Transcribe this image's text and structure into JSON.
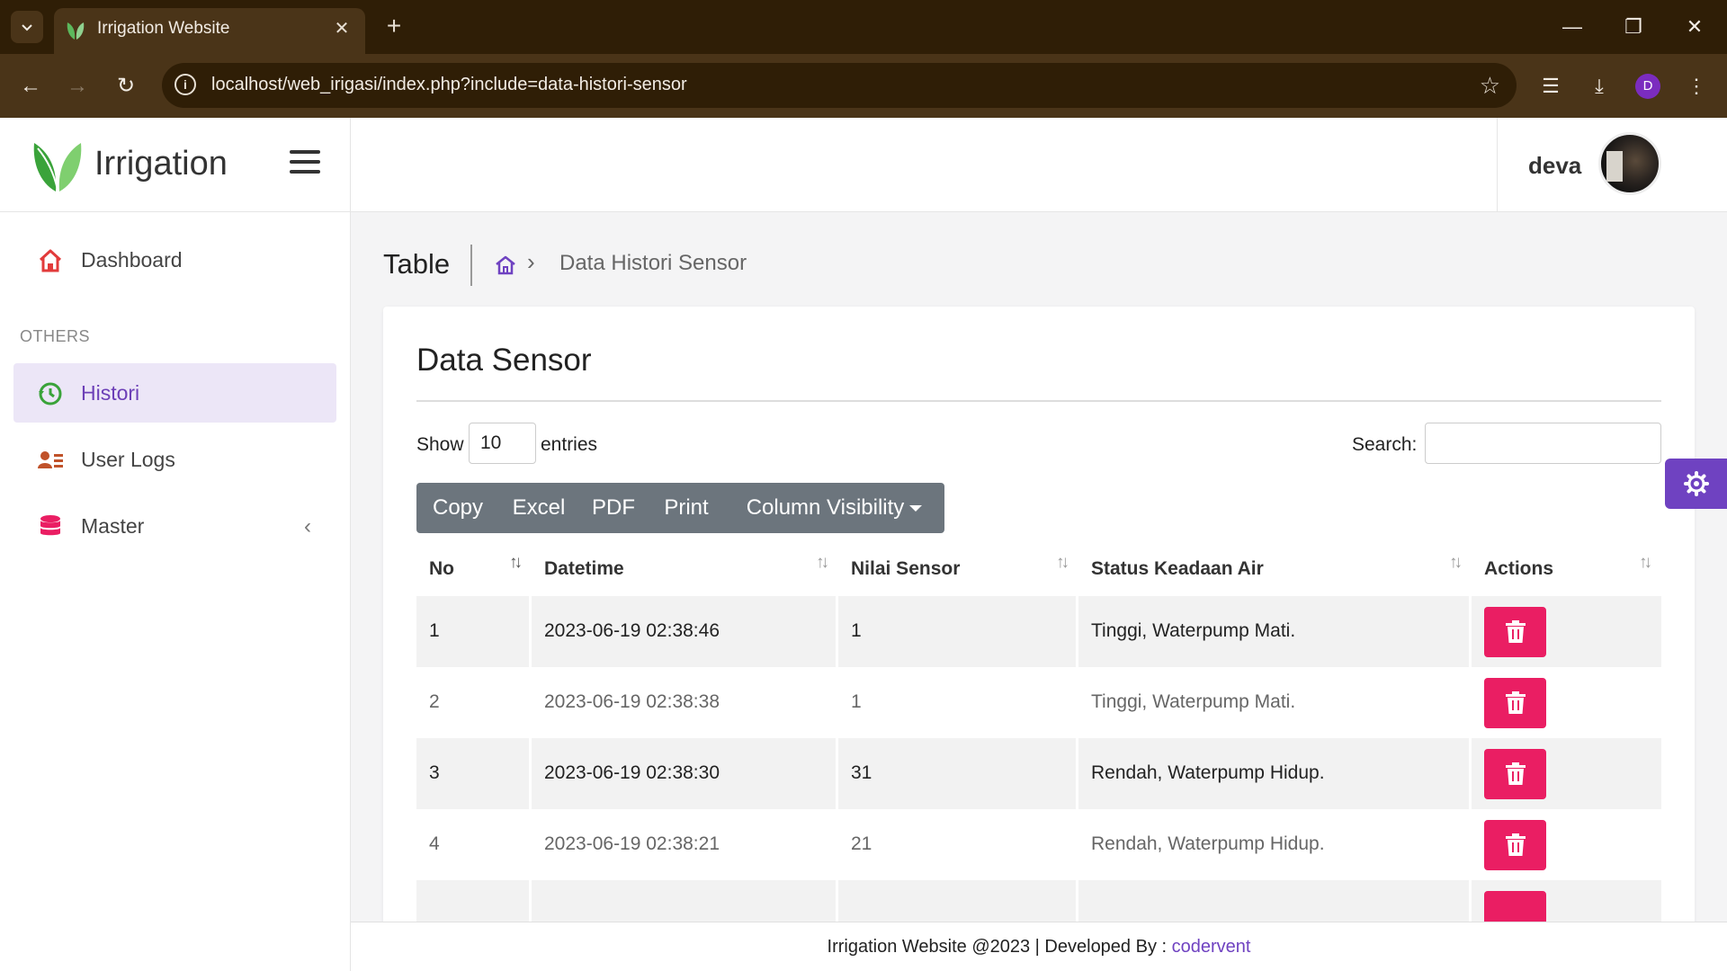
{
  "browser": {
    "tab_title": "Irrigation Website",
    "url": "localhost/web_irigasi/index.php?include=data-histori-sensor",
    "profile_initial": "D"
  },
  "header": {
    "brand": "Irrigation",
    "username": "deva"
  },
  "sidebar": {
    "items": [
      {
        "label": "Dashboard",
        "icon": "home-icon"
      },
      {
        "label": "Histori",
        "icon": "history-icon"
      },
      {
        "label": "User Logs",
        "icon": "user-logs-icon"
      },
      {
        "label": "Master",
        "icon": "database-icon"
      }
    ],
    "section_label": "OTHERS",
    "active": "Histori"
  },
  "page": {
    "title": "Table",
    "breadcrumb_current": "Data Histori Sensor"
  },
  "card": {
    "title": "Data Sensor",
    "show_label": "Show",
    "entries_value": "10",
    "entries_label": "entries",
    "search_label": "Search:",
    "search_value": ""
  },
  "buttons": {
    "copy": "Copy",
    "excel": "Excel",
    "pdf": "PDF",
    "print": "Print",
    "colvis": "Column Visibility"
  },
  "table": {
    "headers": [
      "No",
      "Datetime",
      "Nilai Sensor",
      "Status Keadaan Air",
      "Actions"
    ],
    "rows": [
      {
        "no": "1",
        "datetime": "2023-06-19 02:38:46",
        "nilai": "1",
        "status": "Tinggi, Waterpump Mati."
      },
      {
        "no": "2",
        "datetime": "2023-06-19 02:38:38",
        "nilai": "1",
        "status": "Tinggi, Waterpump Mati."
      },
      {
        "no": "3",
        "datetime": "2023-06-19 02:38:30",
        "nilai": "31",
        "status": "Rendah, Waterpump Hidup."
      },
      {
        "no": "4",
        "datetime": "2023-06-19 02:38:21",
        "nilai": "21",
        "status": "Rendah, Waterpump Hidup."
      }
    ]
  },
  "footer": {
    "text": "Irrigation Website @2023 | Developed By : ",
    "link": "codervent"
  },
  "colors": {
    "accent": "#6f42c1",
    "danger": "#ea1e63",
    "button_group": "#6c757d",
    "browser_dark": "#2f1e06",
    "browser_bar": "#4a3418"
  }
}
